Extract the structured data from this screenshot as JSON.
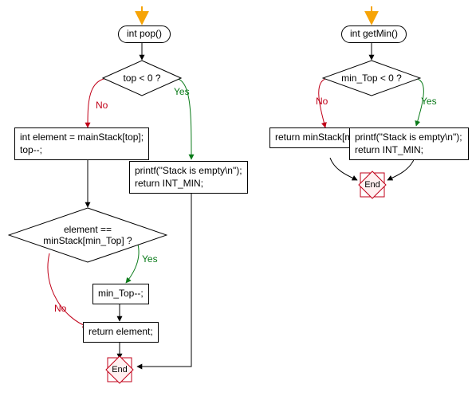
{
  "chart_data": [
    {
      "type": "flowchart",
      "function": "int pop()",
      "nodes": [
        {
          "id": "start_pop",
          "kind": "terminal",
          "text": "int pop()"
        },
        {
          "id": "d_top",
          "kind": "decision",
          "text": "top < 0 ?"
        },
        {
          "id": "p_empty_pop",
          "kind": "process",
          "text": "printf(\"Stack is empty\\n\");\nreturn INT_MIN;"
        },
        {
          "id": "p_elem",
          "kind": "process",
          "text": "int element = mainStack[top];\ntop--;"
        },
        {
          "id": "d_eq",
          "kind": "decision",
          "text": "element ==\nminStack[min_Top] ?"
        },
        {
          "id": "p_dec",
          "kind": "process",
          "text": "min_Top--;"
        },
        {
          "id": "p_ret",
          "kind": "process",
          "text": "return element;"
        },
        {
          "id": "end_pop",
          "kind": "end",
          "text": "End"
        }
      ],
      "edges": [
        {
          "from": "start_pop",
          "to": "d_top"
        },
        {
          "from": "d_top",
          "to": "p_empty_pop",
          "label": "Yes"
        },
        {
          "from": "d_top",
          "to": "p_elem",
          "label": "No"
        },
        {
          "from": "p_elem",
          "to": "d_eq"
        },
        {
          "from": "d_eq",
          "to": "p_dec",
          "label": "Yes"
        },
        {
          "from": "d_eq",
          "to": "p_ret",
          "label": "No"
        },
        {
          "from": "p_dec",
          "to": "p_ret"
        },
        {
          "from": "p_ret",
          "to": "end_pop"
        },
        {
          "from": "p_empty_pop",
          "to": "end_pop"
        }
      ]
    },
    {
      "type": "flowchart",
      "function": "int getMin()",
      "nodes": [
        {
          "id": "start_getmin",
          "kind": "terminal",
          "text": "int getMin()"
        },
        {
          "id": "d_min",
          "kind": "decision",
          "text": "min_Top < 0 ?"
        },
        {
          "id": "p_empty_getmin",
          "kind": "process",
          "text": "printf(\"Stack is empty\\n\");\nreturn INT_MIN;"
        },
        {
          "id": "p_retmin",
          "kind": "process",
          "text": "return minStack[min_Top];"
        },
        {
          "id": "end_getmin",
          "kind": "end",
          "text": "End"
        }
      ],
      "edges": [
        {
          "from": "start_getmin",
          "to": "d_min"
        },
        {
          "from": "d_min",
          "to": "p_empty_getmin",
          "label": "Yes"
        },
        {
          "from": "d_min",
          "to": "p_retmin",
          "label": "No"
        },
        {
          "from": "p_retmin",
          "to": "end_getmin"
        },
        {
          "from": "p_empty_getmin",
          "to": "end_getmin"
        }
      ]
    }
  ],
  "labels": {
    "yes": "Yes",
    "no": "No",
    "end": "End"
  },
  "left": {
    "start": "int pop()",
    "d_top": "top < 0 ?",
    "empty_line1": "printf(\"Stack is empty\\n\");",
    "empty_line2": "return INT_MIN;",
    "elem_line1": "int element = mainStack[top];",
    "elem_line2": "top--;",
    "d_eq_line1": "element ==",
    "d_eq_line2": "minStack[min_Top] ?",
    "dec": "min_Top--;",
    "ret": "return element;"
  },
  "right": {
    "start": "int getMin()",
    "d_min": "min_Top < 0 ?",
    "empty_line1": "printf(\"Stack is empty\\n\");",
    "empty_line2": "return INT_MIN;",
    "retmin": "return minStack[min_Top];"
  },
  "colors": {
    "yes_edge": "#0b7b1a",
    "no_edge": "#c00018",
    "neutral_edge": "#000000",
    "arrow_start": "#f6a407",
    "end_fill": "#fff0f0",
    "end_stroke": "#c00018"
  }
}
